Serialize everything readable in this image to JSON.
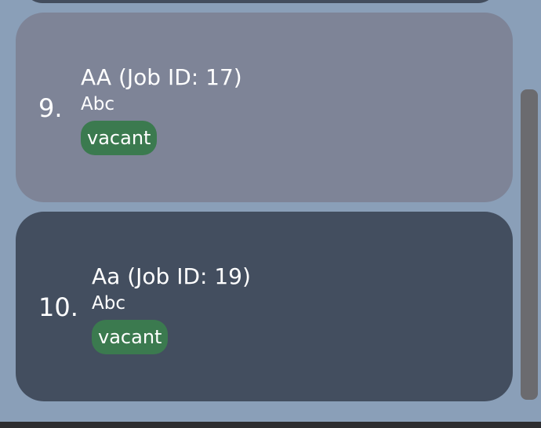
{
  "list": {
    "items": [
      {
        "index": "9.",
        "title": "AA (Job ID: 17)",
        "subtitle": "Abc",
        "status": "vacant"
      },
      {
        "index": "10.",
        "title": "Aa (Job ID: 19)",
        "subtitle": "Abc",
        "status": "vacant"
      }
    ]
  },
  "colors": {
    "background": "#8a9fb8",
    "selected_card": "#7e8497",
    "card": "#434e5f",
    "badge_vacant": "#3b7a4f",
    "scrollbar": "#6b6b6f"
  }
}
